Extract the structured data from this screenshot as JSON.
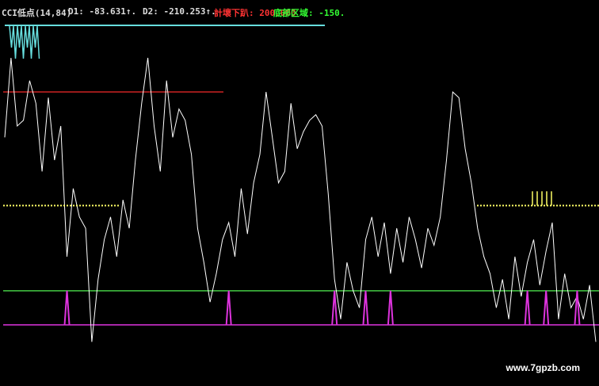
{
  "header": {
    "indicator": "CCI低点(14,84)",
    "d1": "D1: -83.631↑.",
    "d2": "D2: -210.253↑.",
    "buy_line": "計壞下趴: 200.000",
    "bottom_zone": "底部区域: -150."
  },
  "watermark": "www.7gpzb.com",
  "colors": {
    "background": "#000000",
    "cci_line": "#ffffff",
    "yellow_markers": "#ffff66",
    "cyan_line": "#66dddd",
    "red_level": "#cc2222",
    "green_level": "#44cc44",
    "magenta_signal": "#dd33dd",
    "label_white": "#dddddd",
    "label_red": "#ff3333",
    "label_green": "#33ff33"
  },
  "chart_data": {
    "type": "line",
    "title": "CCI低点(14,84)",
    "levels": [
      {
        "name": "red",
        "value": 200
      },
      {
        "name": "yellow",
        "value": 0
      },
      {
        "name": "green",
        "value": -150
      },
      {
        "name": "magenta",
        "value": -210
      }
    ],
    "ylim": [
      -280,
      320
    ],
    "grid": false,
    "series": [
      {
        "values": [
          120,
          260,
          140,
          150,
          220,
          180,
          60,
          190,
          80,
          140,
          -90,
          30,
          -20,
          -40,
          -240,
          -130,
          -60,
          -20,
          -90,
          10,
          -40,
          80,
          180,
          260,
          140,
          60,
          220,
          120,
          170,
          150,
          90,
          -40,
          -100,
          -170,
          -120,
          -60,
          -30,
          -90,
          30,
          -50,
          40,
          90,
          200,
          120,
          40,
          60,
          180,
          100,
          130,
          150,
          160,
          140,
          20,
          -130,
          -200,
          -100,
          -150,
          -180,
          -60,
          -20,
          -90,
          -30,
          -120,
          -40,
          -100,
          -20,
          -60,
          -110,
          -40,
          -70,
          -20,
          80,
          200,
          190,
          100,
          40,
          -40,
          -90,
          -120,
          -180,
          -130,
          -200,
          -90,
          -160,
          -100,
          -60,
          -140,
          -80,
          -30,
          -200,
          -120,
          -180,
          -160,
          -200,
          -140,
          -240
        ],
        "range_note": ""
      }
    ],
    "signals_at_index": [
      10,
      36,
      53,
      58,
      62,
      84,
      87,
      92
    ]
  }
}
